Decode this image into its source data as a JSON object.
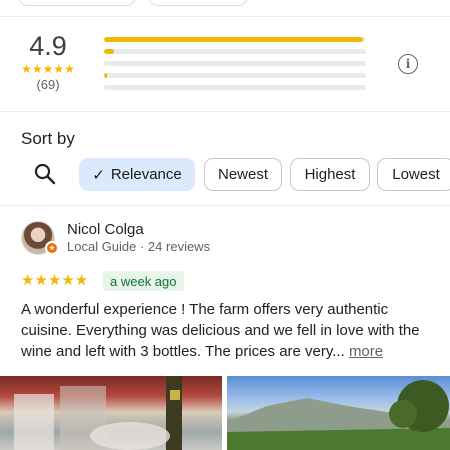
{
  "summary": {
    "rating": "4.9",
    "stars": "★★★★★",
    "count": "(69)",
    "distribution": [
      0.99,
      0.04,
      0.0,
      0.01,
      0.0
    ]
  },
  "sort": {
    "label": "Sort by",
    "chips": [
      {
        "label": "Relevance",
        "selected": true
      },
      {
        "label": "Newest",
        "selected": false
      },
      {
        "label": "Highest",
        "selected": false
      },
      {
        "label": "Lowest",
        "selected": false
      }
    ]
  },
  "review": {
    "name": "Nicol Colga",
    "meta": "Local Guide · 24 reviews",
    "stars": "★★★★★",
    "time": "a week ago",
    "text": "A wonderful experience ! The farm offers very authentic cuisine. Everything was delicious and we fell in love with the wine and left with 3 bottles. The prices are very... ",
    "more": "more"
  },
  "colors": {
    "star": "#f2b705",
    "selected_chip": "#dce9fd",
    "time_badge_bg": "#e6f4ea",
    "time_badge_text": "#137333"
  },
  "icons": {
    "info": "info-icon",
    "search": "search-icon",
    "check": "check-icon",
    "guide_badge": "local-guide-badge-icon"
  }
}
